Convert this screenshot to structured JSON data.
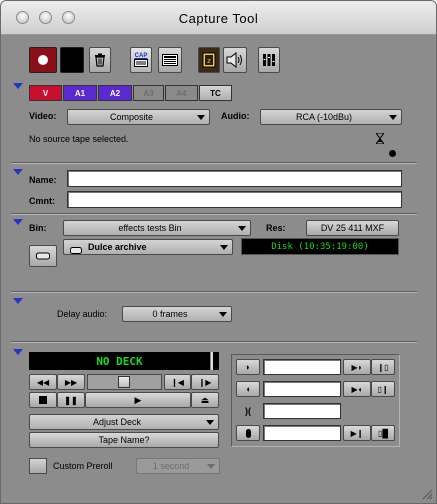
{
  "window": {
    "title": "Capture Tool"
  },
  "toolbar": {
    "cap_label": "CAP",
    "icons": [
      "record-icon",
      "stop-square-icon",
      "trash-icon",
      "capture-mode-icon",
      "log-mode-icon",
      "filmstrip-icon",
      "speaker-icon",
      "audio-meter-icon"
    ]
  },
  "tracks": [
    {
      "label": "V",
      "state": "on"
    },
    {
      "label": "A1",
      "state": "on"
    },
    {
      "label": "A2",
      "state": "on"
    },
    {
      "label": "A3",
      "state": "off"
    },
    {
      "label": "A4",
      "state": "off"
    },
    {
      "label": "TC",
      "state": "plain"
    }
  ],
  "source": {
    "video_label": "Video:",
    "video_value": "Composite",
    "audio_label": "Audio:",
    "audio_value": "RCA (-10dBu)",
    "status": "No source tape selected."
  },
  "clip": {
    "name_label": "Name:",
    "name_value": "",
    "comment_label": "Cmnt:",
    "comment_value": ""
  },
  "target": {
    "bin_label": "Bin:",
    "bin_value": "effects tests Bin",
    "res_label": "Res:",
    "res_value": "DV 25 411 MXF",
    "disk_value": "Dulce archive",
    "disk_status": "Disk (10:35:19:00)"
  },
  "delay": {
    "label": "Delay audio:",
    "value": "0 frames"
  },
  "deck": {
    "status": "NO DECK",
    "adjust_label": "Adjust Deck",
    "tape_label": "Tape Name?",
    "preroll_label": "Custom Preroll",
    "preroll_checked": false,
    "preroll_value": "1 second",
    "mark_in_value": "",
    "mark_out_value": "",
    "duration_value": "",
    "timecode_value": ""
  },
  "colors": {
    "window_bg": "#8c8c8c",
    "track_video_on": "#c8102e",
    "track_audio_on": "#5a2ad0",
    "lcd_text": "#1fd81f",
    "disclosure": "#2236c8"
  }
}
